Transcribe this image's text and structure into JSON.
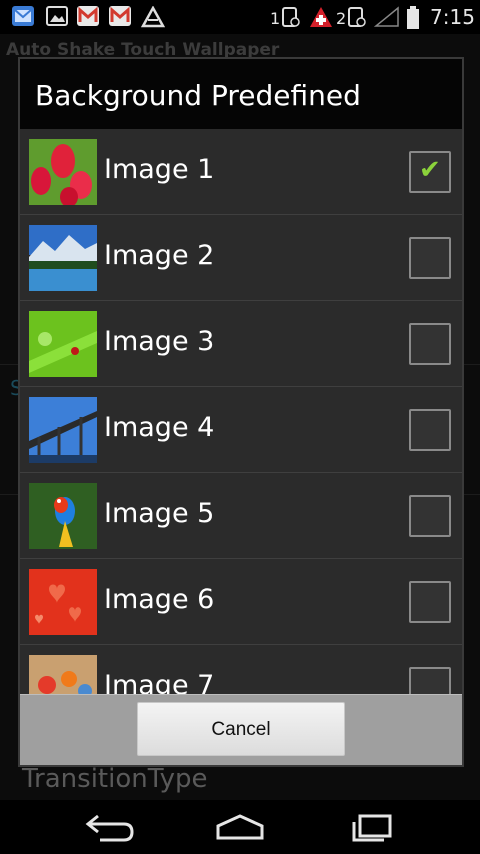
{
  "status_bar": {
    "sim1": "1",
    "sim2": "2",
    "time": "7:15",
    "icons": [
      "email-app-icon",
      "gallery-icon",
      "gmail-icon",
      "gmail-icon",
      "store-icon",
      "sim1-icon",
      "red-cross-icon",
      "sim2-icon",
      "signal-icon",
      "battery-icon"
    ]
  },
  "background": {
    "app_title": "Auto Shake Touch Wallpaper",
    "s_fragment": "S",
    "transition_label": "TransitionType"
  },
  "dialog": {
    "title": "Background Predefined",
    "items": [
      {
        "label": "Image 1",
        "checked": true
      },
      {
        "label": "Image 2",
        "checked": false
      },
      {
        "label": "Image 3",
        "checked": false
      },
      {
        "label": "Image 4",
        "checked": false
      },
      {
        "label": "Image 5",
        "checked": false
      },
      {
        "label": "Image 6",
        "checked": false
      },
      {
        "label": "Image 7",
        "checked": false
      }
    ],
    "cancel_label": "Cancel"
  },
  "nav": {
    "buttons": [
      "back-icon",
      "home-icon",
      "recent-apps-icon"
    ]
  },
  "colors": {
    "check_accent": "#8bd23b"
  }
}
